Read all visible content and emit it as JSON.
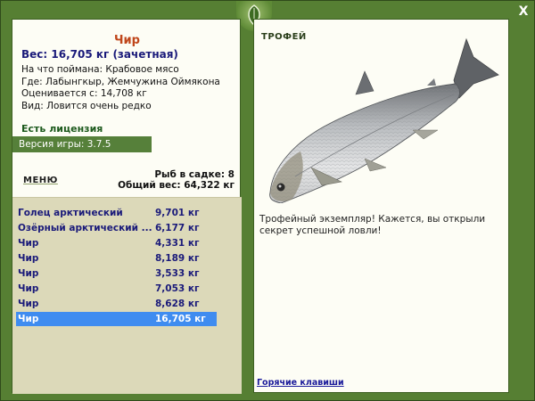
{
  "window": {
    "close_label": "X"
  },
  "fish_details": {
    "name": "Чир",
    "weight_line": "Вес: 16,705 кг (зачетная)",
    "caught_on": "На что поймана: Крабовое мясо",
    "location": "Где: Лабынгкыр, Жемчужина Оймякона",
    "valued_from": "Оценивается с: 14,708 кг",
    "rarity": "Вид: Ловится очень редко"
  },
  "license": "Есть лицензия",
  "version": "Версия игры: 3.7.5",
  "menu_title": "МЕНЮ",
  "cage": {
    "fish_count": "Рыб в садке: 8",
    "total_weight": "Общий вес: 64,322 кг"
  },
  "catch_list": [
    {
      "name": "Голец арктический",
      "weight": "9,701 кг"
    },
    {
      "name": "Озёрный арктический ...",
      "weight": "6,177 кг"
    },
    {
      "name": "Чир",
      "weight": "4,331 кг"
    },
    {
      "name": "Чир",
      "weight": "8,189 кг"
    },
    {
      "name": "Чир",
      "weight": "3,533 кг"
    },
    {
      "name": "Чир",
      "weight": "7,053 кг"
    },
    {
      "name": "Чир",
      "weight": "8,628 кг"
    },
    {
      "name": "Чир",
      "weight": "16,705 кг"
    }
  ],
  "selected_index": 7,
  "trophy": {
    "title": "ТРОФЕЙ",
    "message": "Трофейный экземпляр! Кажется, вы открыли секрет успешной ловли!",
    "fish_image": "whitefish-image"
  },
  "hotkeys_link": "Горячие клавиши",
  "colors": {
    "frame": "#567f33",
    "panel": "#fdfdf5",
    "list_bg": "#dcd9b9",
    "selected": "#3f8cf0",
    "name_accent": "#c0471c",
    "list_text": "#1a1a7a"
  }
}
